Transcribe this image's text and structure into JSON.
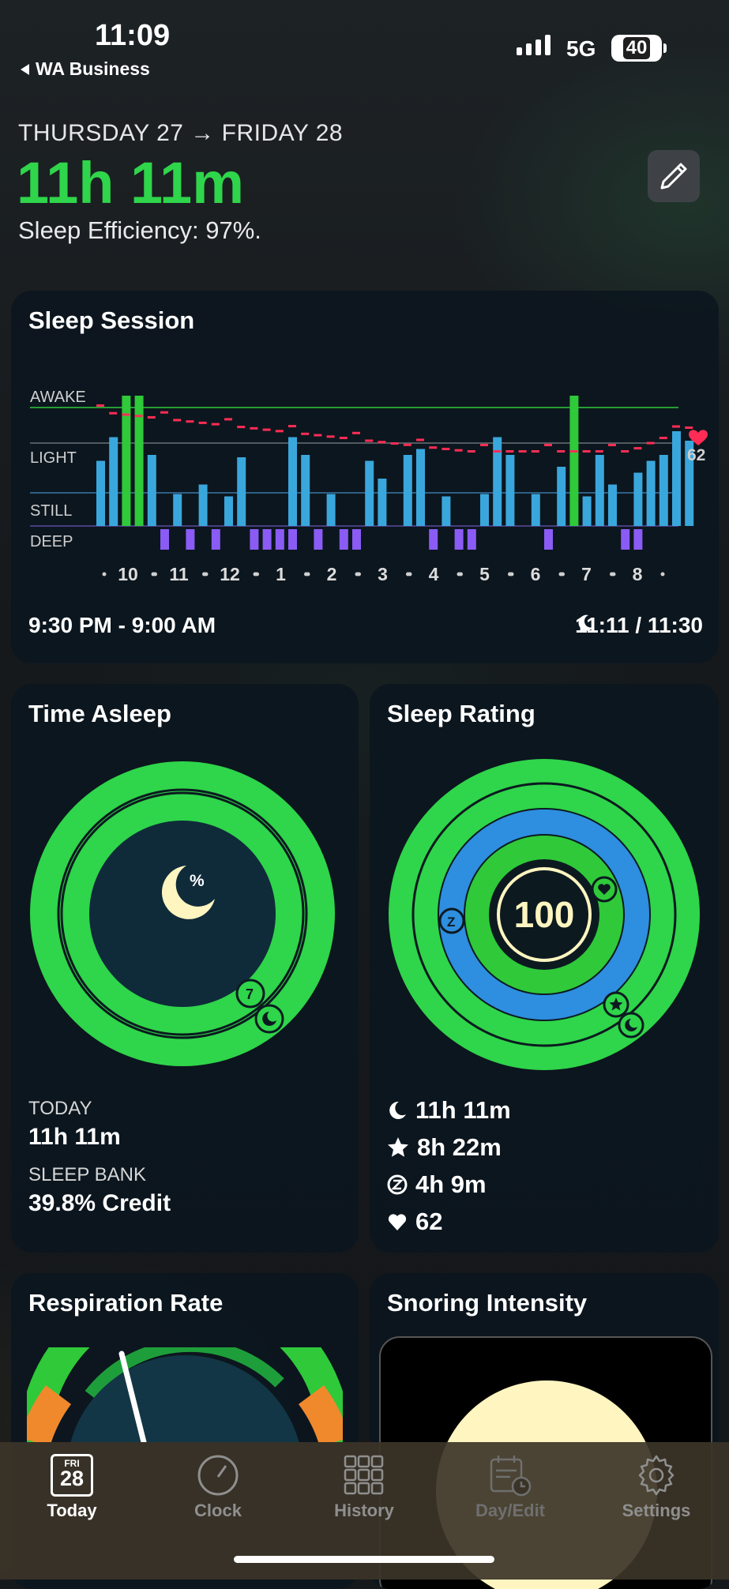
{
  "status_bar": {
    "time": "11:09",
    "back_app": "WA Business",
    "network": "5G",
    "battery": "40"
  },
  "header": {
    "date_range": "THURSDAY 27 → FRIDAY 28",
    "duration": "11h 11m",
    "efficiency": "Sleep Efficiency: 97%."
  },
  "session": {
    "title": "Sleep Session",
    "levels": [
      "AWAKE",
      "LIGHT",
      "STILL",
      "DEEP"
    ],
    "hours": [
      "10",
      "11",
      "12",
      "1",
      "2",
      "3",
      "4",
      "5",
      "6",
      "7",
      "8"
    ],
    "heart_rate": "62",
    "time_range": "9:30 PM - 9:00 AM",
    "ratio": "11:11 / 11:30",
    "colors": {
      "awake": "#2fc93a",
      "light": "#3aa7dc",
      "deep": "#8a5cf5",
      "hr": "#ff2d55"
    },
    "chart_data": {
      "type": "bar",
      "title": "Sleep Session",
      "legend": [
        "AWAKE",
        "LIGHT",
        "STILL",
        "DEEP"
      ],
      "x_ticks": [
        "10",
        "11",
        "12",
        "1",
        "2",
        "3",
        "4",
        "5",
        "6",
        "7",
        "8"
      ],
      "activity": [
        0.55,
        0.75,
        1.1,
        1.1,
        0.6,
        0,
        0.27,
        0,
        0.35,
        0,
        0.25,
        0.58,
        0,
        0,
        0,
        0.75,
        0.6,
        0,
        0.27,
        0,
        0,
        0.55,
        0.4,
        0,
        0.6,
        0.65,
        0,
        0.25,
        0,
        0,
        0.27,
        0.75,
        0.6,
        0,
        0.27,
        0,
        0.5,
        1.1,
        0.25,
        0.6,
        0.35,
        0,
        0.45,
        0.55,
        0.6,
        0.8,
        0.72
      ],
      "deep": [
        0,
        0,
        0,
        0,
        0,
        1,
        0,
        1,
        0,
        1,
        0,
        0,
        1,
        1,
        1,
        1,
        0,
        1,
        0,
        1,
        1,
        0,
        0,
        0,
        0,
        0,
        1,
        0,
        1,
        1,
        0,
        0,
        0,
        0,
        0,
        1,
        0,
        0,
        0,
        0,
        0,
        1,
        1,
        0,
        0,
        0,
        0
      ],
      "heart_rate_end": 62
    }
  },
  "asleep": {
    "title": "Time Asleep",
    "percent_symbol": "%",
    "badge": "7",
    "today_label": "TODAY",
    "today_value": "11h 11m",
    "bank_label": "SLEEP BANK",
    "bank_value": "39.8% Credit"
  },
  "rating": {
    "title": "Sleep Rating",
    "score": "100",
    "z_badge": "Z",
    "stats": {
      "asleep": "11h 11m",
      "quality": "8h 22m",
      "deep": "4h 9m",
      "hr": "62"
    }
  },
  "resp": {
    "title": "Respiration Rate"
  },
  "snore": {
    "title": "Snoring Intensity"
  },
  "tabs": [
    {
      "label": "Today",
      "day": "FRI",
      "date": "28"
    },
    {
      "label": "Clock"
    },
    {
      "label": "History"
    },
    {
      "label": "Day/Edit"
    },
    {
      "label": "Settings"
    }
  ]
}
